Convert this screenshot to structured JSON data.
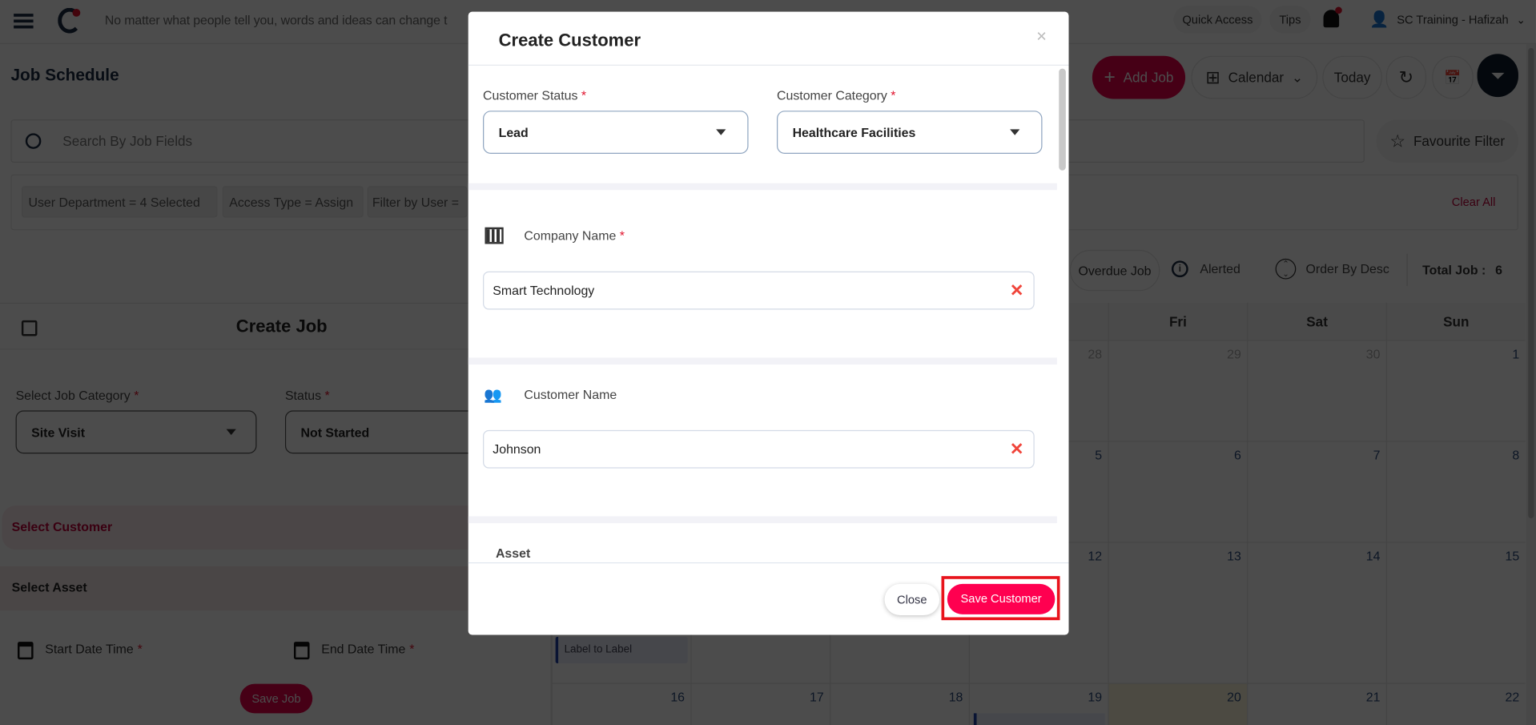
{
  "topbar": {
    "quote": "No matter what people tell you, words and ideas can change t",
    "quick_access": "Quick Access",
    "tips": "Tips",
    "user_name": "SC Training - Hafizah",
    "icons": [
      "menu-icon",
      "logo",
      "bell-icon",
      "user-icon",
      "chevron-down-icon"
    ]
  },
  "header": {
    "title": "Job Schedule",
    "add_job": "Add Job",
    "view": "Calendar",
    "today": "Today"
  },
  "search": {
    "placeholder": "Search By Job Fields",
    "favourite": "Favourite Filter"
  },
  "filters": {
    "chips": [
      "User Department = 4 Selected",
      "Access Type = Assign",
      "Filter by User ="
    ],
    "clear_all": "Clear All"
  },
  "legend": {
    "overdue": "Overdue Job",
    "alerted": "Alerted",
    "order": "Order By Desc",
    "total_label": "Total Job :",
    "total_value": "6"
  },
  "create_job": {
    "title": "Create Job",
    "category_label": "Select Job Category",
    "category_value": "Site Visit",
    "status_label": "Status",
    "status_value": "Not Started",
    "select_customer": "Select Customer",
    "select_asset": "Select Asset",
    "start_label": "Start Date Time",
    "end_label": "End Date Time",
    "save": "Save Job"
  },
  "calendar": {
    "days": [
      "Fri",
      "Sat",
      "Sun"
    ],
    "rows": [
      [
        "28",
        "29",
        "30",
        "1"
      ],
      [
        "5",
        "6",
        "7",
        "8"
      ],
      [
        "12",
        "13",
        "14",
        "15"
      ],
      [
        "16",
        "17",
        "18",
        "19",
        "20",
        "21",
        "22"
      ]
    ],
    "event_label": "Label to Label",
    "today_date": "20"
  },
  "modal": {
    "title": "Create Customer",
    "status_label": "Customer Status",
    "status_value": "Lead",
    "category_label": "Customer Category",
    "category_value": "Healthcare Facilities",
    "company_label": "Company Name",
    "company_value": "Smart Technology",
    "customer_label": "Customer Name",
    "customer_value": "Johnson",
    "asset_label": "Asset",
    "close": "Close",
    "save": "Save Customer",
    "required_mark": "*"
  },
  "colors": {
    "accent": "#ff0050",
    "highlight": "#e8141c",
    "navy": "#0d1b2a"
  }
}
